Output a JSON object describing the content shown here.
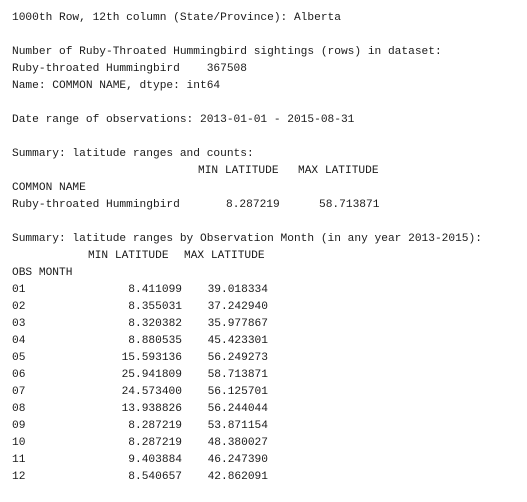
{
  "header_line": "1000th Row, 12th column (State/Province): Alberta",
  "count_section": {
    "title": "Number of Ruby-Throated Hummingbird sightings (rows) in dataset:",
    "value_line": "Ruby-throated Hummingbird    367508",
    "dtype_line": "Name: COMMON NAME, dtype: int64"
  },
  "date_range_line": "Date range of observations: 2013-01-01 - 2015-08-31",
  "species_summary": {
    "title": "Summary: latitude ranges and counts:",
    "col_min": "MIN LATITUDE",
    "col_max": "MAX LATITUDE",
    "index_name": "COMMON NAME",
    "row": {
      "name": "Ruby-throated Hummingbird",
      "min": "8.287219",
      "max": "58.713871"
    }
  },
  "month_summary": {
    "title": "Summary: latitude ranges by Observation Month (in any year 2013-2015):",
    "col_min": "MIN LATITUDE",
    "col_max": "MAX LATITUDE",
    "index_name": "OBS MONTH",
    "rows": [
      {
        "month": "01",
        "min": "8.411099",
        "max": "39.018334"
      },
      {
        "month": "02",
        "min": "8.355031",
        "max": "37.242940"
      },
      {
        "month": "03",
        "min": "8.320382",
        "max": "35.977867"
      },
      {
        "month": "04",
        "min": "8.880535",
        "max": "45.423301"
      },
      {
        "month": "05",
        "min": "15.593136",
        "max": "56.249273"
      },
      {
        "month": "06",
        "min": "25.941809",
        "max": "58.713871"
      },
      {
        "month": "07",
        "min": "24.573400",
        "max": "56.125701"
      },
      {
        "month": "08",
        "min": "13.938826",
        "max": "56.244044"
      },
      {
        "month": "09",
        "min": "8.287219",
        "max": "53.871154"
      },
      {
        "month": "10",
        "min": "8.287219",
        "max": "48.380027"
      },
      {
        "month": "11",
        "min": "9.403884",
        "max": "46.247390"
      },
      {
        "month": "12",
        "min": "8.540657",
        "max": "42.862091"
      }
    ]
  }
}
